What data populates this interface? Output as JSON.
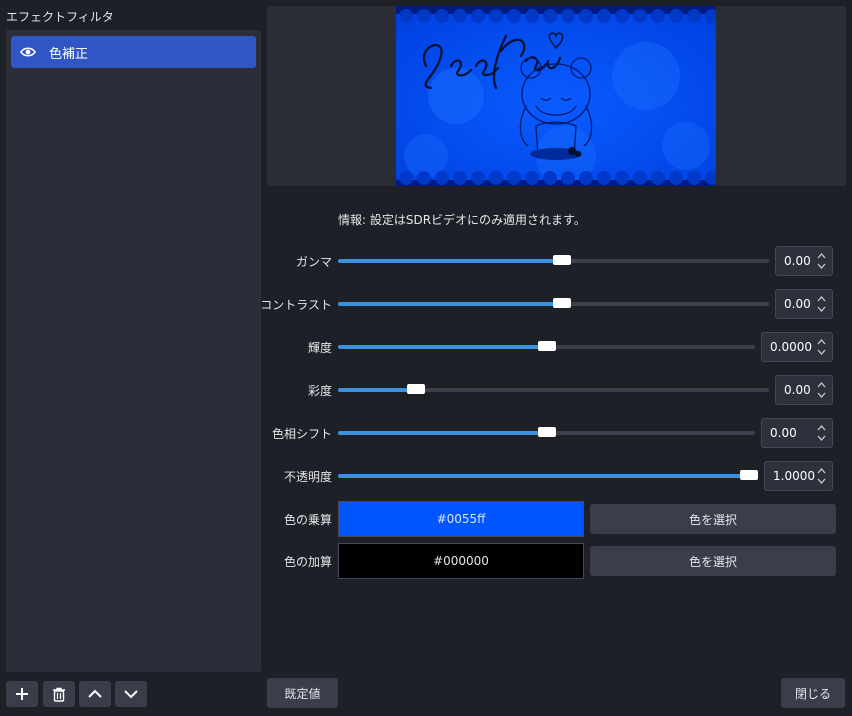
{
  "left_panel": {
    "title": "エフェクトフィルタ",
    "filters": [
      {
        "label": "色補正",
        "icon": "eye-icon",
        "selected": true
      }
    ],
    "toolbar": {
      "add_icon": "plus-icon",
      "delete_icon": "trash-icon",
      "up_icon": "chevron-up-icon",
      "down_icon": "chevron-down-icon"
    }
  },
  "info": "情報: 設定はSDRビデオにのみ適用されます。",
  "properties": {
    "gamma": {
      "label": "ガンマ",
      "value": "0.00",
      "fraction": 0.52
    },
    "contrast": {
      "label": "コントラスト",
      "value": "0.00",
      "fraction": 0.52
    },
    "brightness": {
      "label": "輝度",
      "value": "0.0000",
      "fraction": 0.5
    },
    "saturation": {
      "label": "彩度",
      "value": "0.00",
      "fraction": 0.18
    },
    "hue_shift": {
      "label": "色相シフト",
      "value": "0.00",
      "fraction": 0.5
    },
    "opacity": {
      "label": "不透明度",
      "value": "1.0000",
      "fraction": 1.0
    }
  },
  "colors": {
    "multiply": {
      "label": "色の乗算",
      "value": "#0055ff",
      "button": "色を選択"
    },
    "add": {
      "label": "色の加算",
      "value": "#000000",
      "button": "色を選択"
    }
  },
  "buttons": {
    "defaults": "既定値",
    "close": "閉じる"
  },
  "theme": {
    "accent": "#3d8fe0",
    "selected_item": "#2f56c4"
  }
}
